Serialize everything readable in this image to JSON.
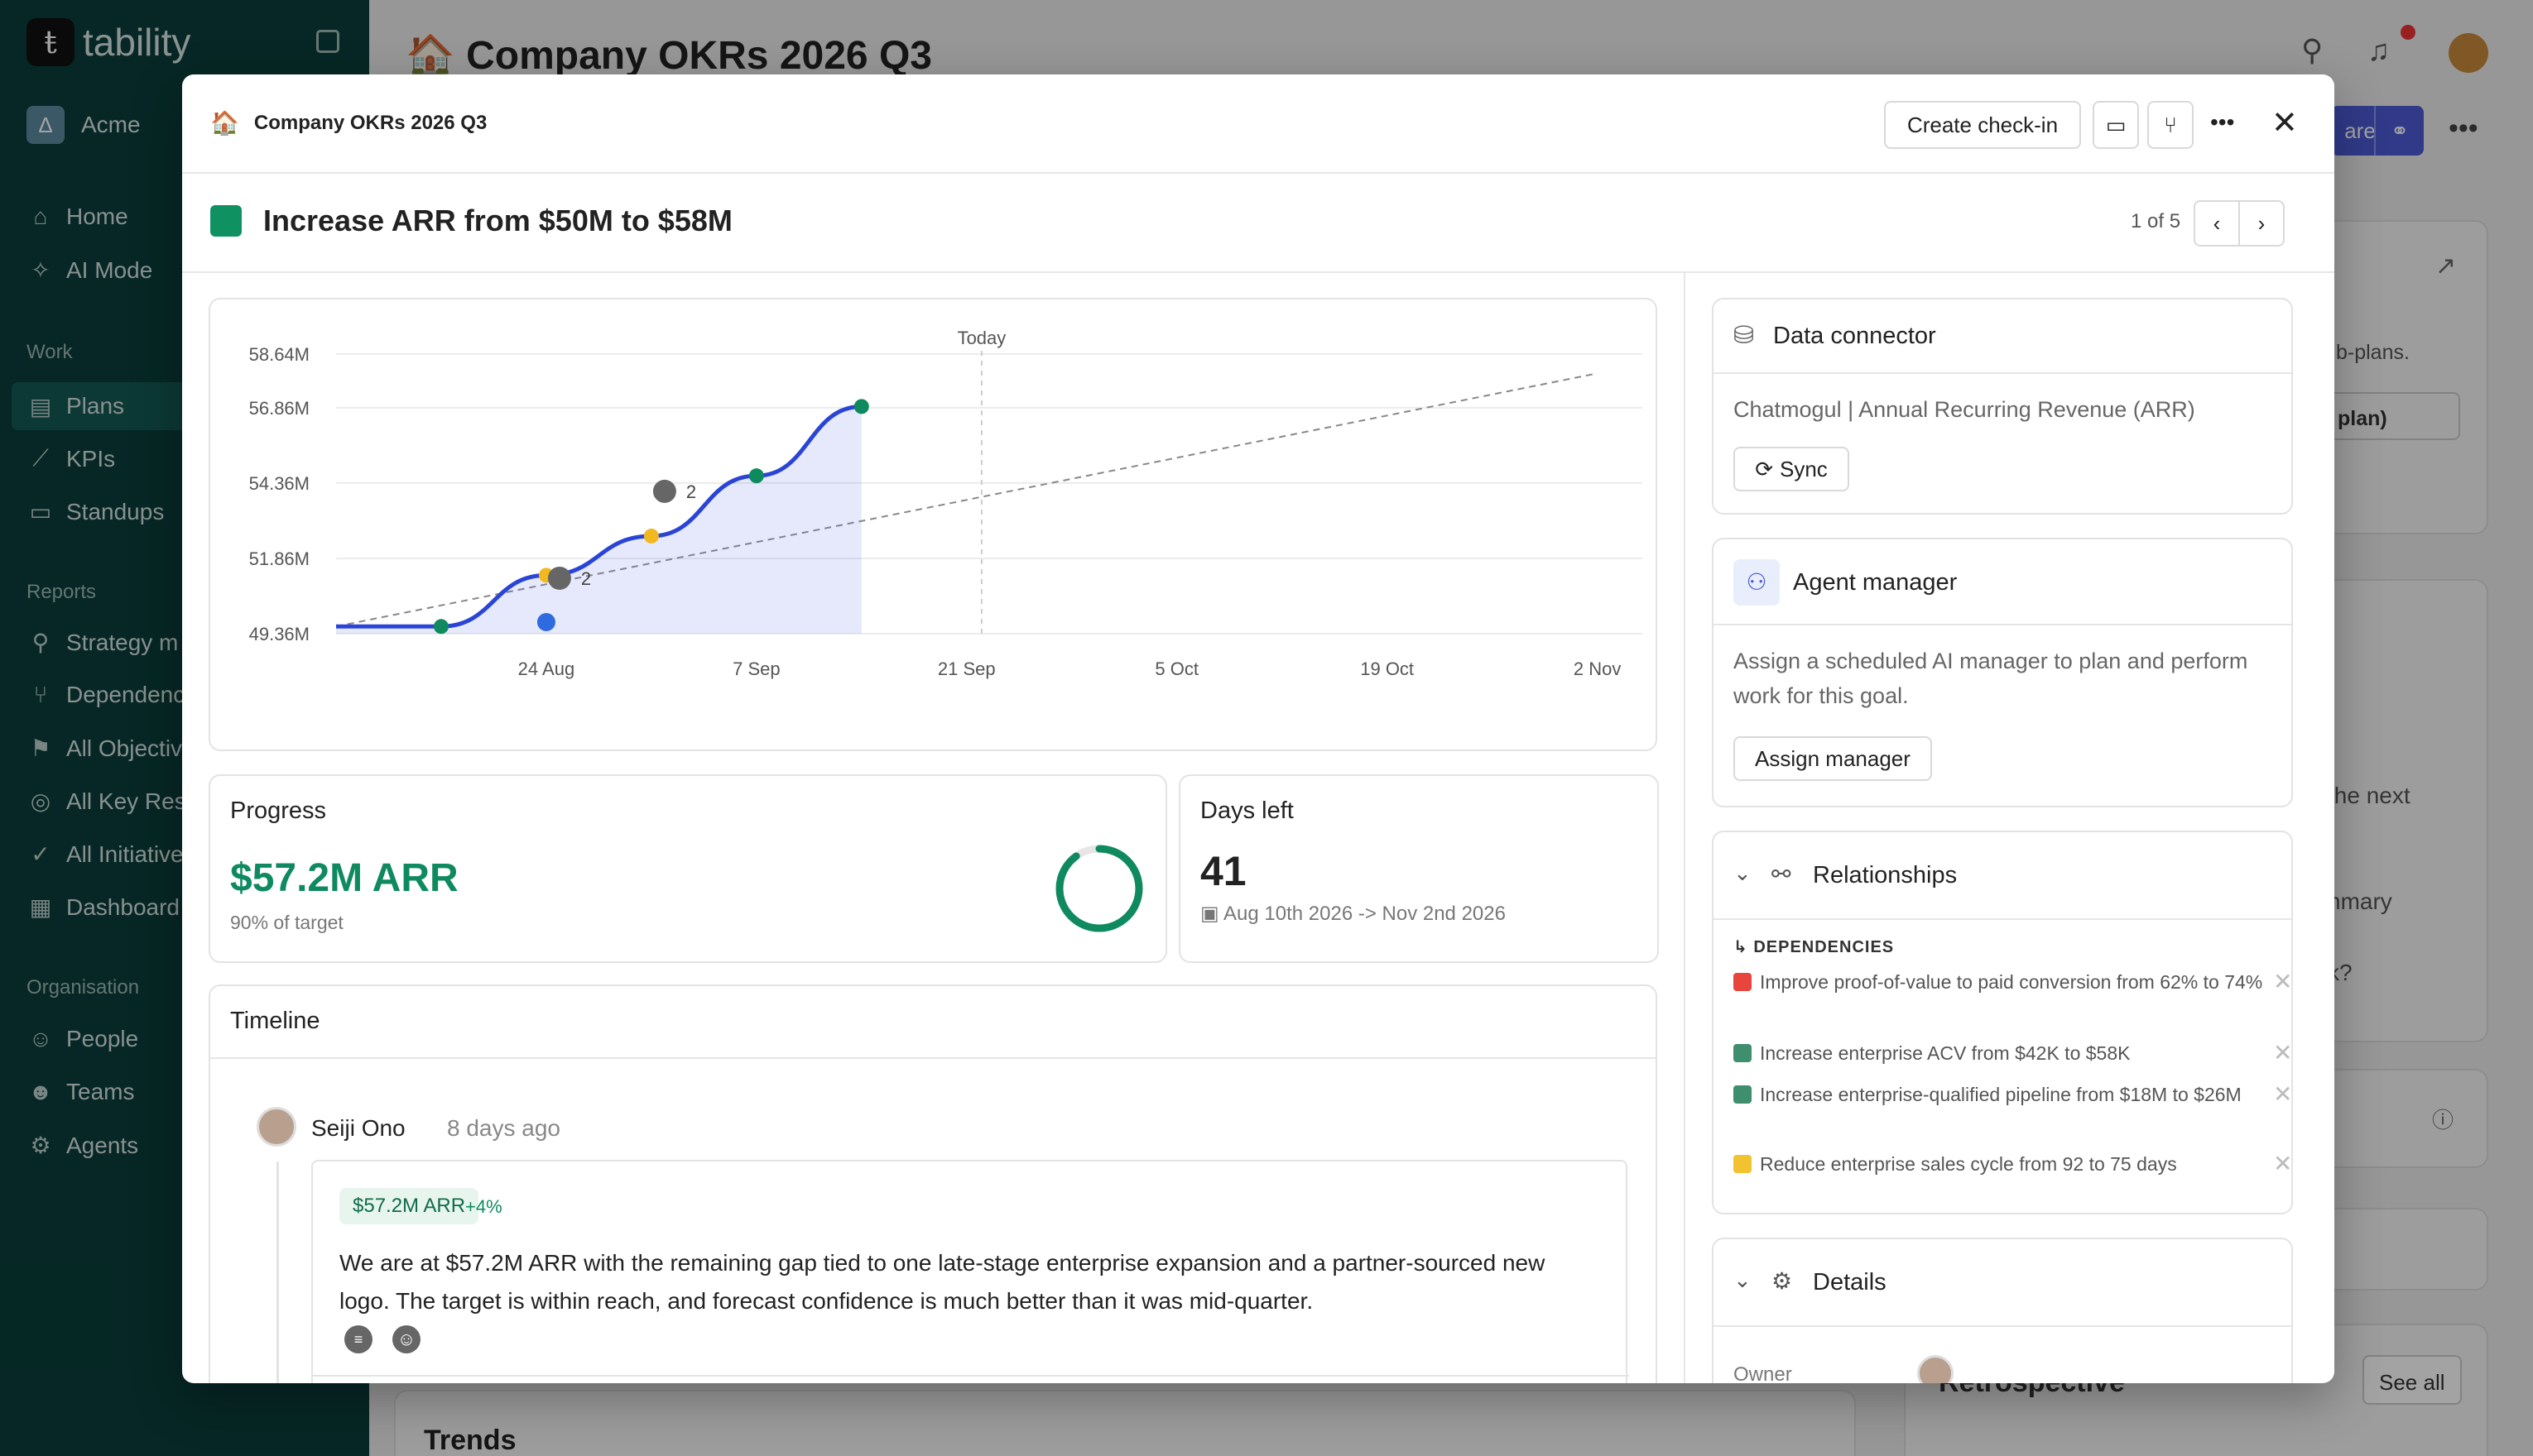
{
  "app": {
    "name": "tability",
    "org": "Acme"
  },
  "sidebar": {
    "nav": [
      {
        "label": "Home",
        "icon": "home-icon"
      },
      {
        "label": "AI Mode",
        "icon": "sparkle-icon"
      }
    ],
    "work_label": "Work",
    "work": [
      {
        "label": "Plans",
        "icon": "plans-icon"
      },
      {
        "label": "KPIs",
        "icon": "chart-line-icon"
      },
      {
        "label": "Standups",
        "icon": "chat-icon"
      }
    ],
    "reports_label": "Reports",
    "reports": [
      {
        "label": "Strategy m",
        "icon": "strategy-icon"
      },
      {
        "label": "Dependenc",
        "icon": "dependency-icon"
      },
      {
        "label": "All Objectiv",
        "icon": "flag-icon"
      },
      {
        "label": "All Key Res",
        "icon": "target-icon"
      },
      {
        "label": "All Initiative",
        "icon": "check-circle-icon"
      },
      {
        "label": "Dashboard",
        "icon": "dashboard-icon"
      }
    ],
    "org_label": "Organisation",
    "org": [
      {
        "label": "People",
        "icon": "people-icon"
      },
      {
        "label": "Teams",
        "icon": "teams-icon"
      },
      {
        "label": "Agents",
        "icon": "robot-icon"
      }
    ]
  },
  "background": {
    "page_title": "Company OKRs 2026 Q3",
    "share_label": "are",
    "subplans_text": "b-plans.",
    "plan_btn": "plan)",
    "next_text": "the next",
    "summary_text": "nmary",
    "k_text": "k?",
    "trends": "Trends",
    "retro": "Retrospective",
    "see_all": "See all"
  },
  "modal": {
    "breadcrumb": "Company OKRs 2026 Q3",
    "create_checkin": "Create check-in",
    "goal_title": "Increase ARR from $50M to $58M",
    "pager": "1 of 5",
    "progress": {
      "label": "Progress",
      "value": "$57.2M ARR",
      "sub": "90% of target",
      "ring_fraction": 0.9
    },
    "days_left": {
      "label": "Days left",
      "value": "41",
      "range": "Aug 10th 2026 -> Nov 2nd 2026"
    },
    "timeline": {
      "label": "Timeline",
      "author": "Seiji Ono",
      "when": "8 days ago",
      "tag": "$57.2M ARR",
      "delta": "+4%",
      "body": "We are at $57.2M ARR with the remaining gap tied to one late-stage enterprise expansion and a partner-sourced new logo. The target is within reach, and forecast confidence is much better than it was mid-quarter."
    },
    "data_connector": {
      "title": "Data connector",
      "source": "Chatmogul | Annual Recurring Revenue (ARR)",
      "sync": "Sync"
    },
    "agent_manager": {
      "title": "Agent manager",
      "desc": "Assign a scheduled AI manager to plan and perform work for this goal.",
      "button": "Assign manager"
    },
    "relationships": {
      "title": "Relationships",
      "deps_label": "DEPENDENCIES",
      "items": [
        {
          "text": "Improve proof-of-value to paid conversion from 62% to 74%",
          "color": "#e8453c"
        },
        {
          "text": "Increase enterprise ACV from $42K to $58K",
          "color": "#3f8f6f"
        },
        {
          "text": "Increase enterprise-qualified pipeline from $18M to $26M",
          "color": "#3f8f6f"
        },
        {
          "text": "Reduce enterprise sales cycle from 92 to 75 days",
          "color": "#f2c230"
        }
      ]
    },
    "details": {
      "title": "Details",
      "owner_label": "Owner"
    }
  },
  "chart_data": {
    "type": "line",
    "title": "",
    "y_ticks": [
      "58.64M",
      "56.86M",
      "54.36M",
      "51.86M",
      "49.36M"
    ],
    "x_ticks": [
      "24 Aug",
      "7 Sep",
      "21 Sep",
      "5 Oct",
      "19 Oct",
      "2 Nov"
    ],
    "today_label": "Today",
    "ylim": [
      49.36,
      58.64
    ],
    "series": [
      {
        "values_x": [
          "2026-08-10",
          "2026-08-17",
          "2026-08-24",
          "2026-08-31",
          "2026-09-07",
          "2026-09-14"
        ],
        "values_y": [
          49.6,
          49.6,
          51.3,
          52.6,
          54.6,
          56.9
        ]
      }
    ],
    "target_line": {
      "from": [
        "2026-08-10",
        49.6
      ],
      "to": [
        "2026-11-02",
        58.0
      ]
    },
    "annotations": [
      {
        "label": "2",
        "x": "2026-08-24"
      },
      {
        "label": "2",
        "x": "2026-08-31"
      }
    ]
  }
}
